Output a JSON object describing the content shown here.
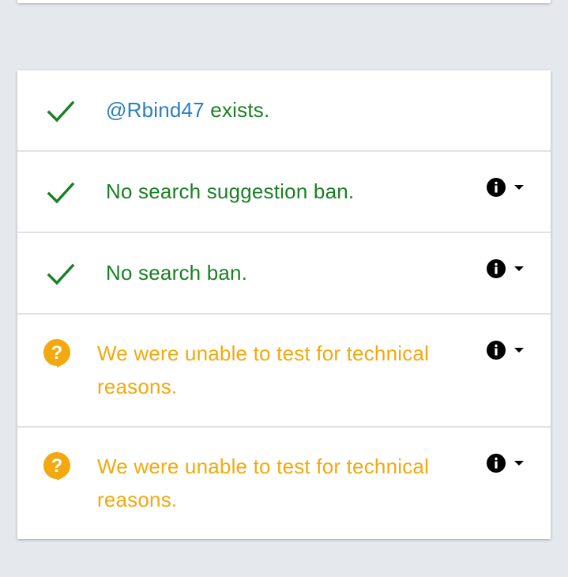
{
  "items": [
    {
      "status": "ok",
      "handle": "@Rbind47",
      "text": " exists.",
      "has_details": false
    },
    {
      "status": "ok",
      "text": "No search suggestion ban.",
      "has_details": true
    },
    {
      "status": "ok",
      "text": "No search ban.",
      "has_details": true
    },
    {
      "status": "unknown",
      "text": "We were unable to test for technical reasons.",
      "has_details": true
    },
    {
      "status": "unknown",
      "text": "We were unable to test for technical reasons.",
      "has_details": true
    }
  ],
  "icons": {
    "ok": "check-icon",
    "unknown": "question-icon",
    "details": "info-icon",
    "expand": "caret-down-icon"
  },
  "colors": {
    "ok": "#1a7f23",
    "unknown": "#f2a90f",
    "handle": "#2a7fbd",
    "background": "#e5e9ee"
  }
}
